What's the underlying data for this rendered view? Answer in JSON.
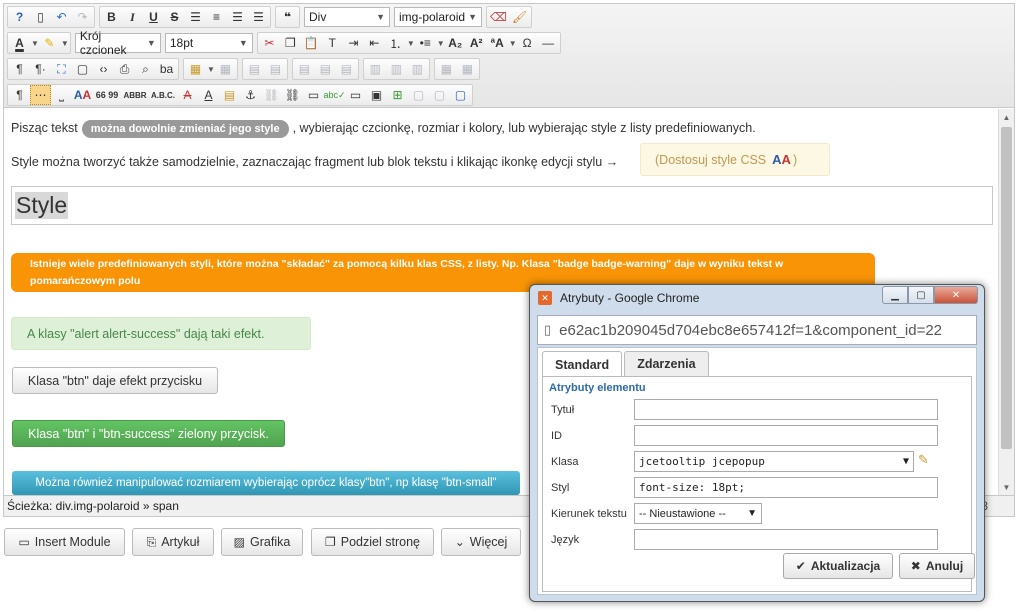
{
  "toolbar": {
    "format_select": "Div",
    "class_select": "img-polaroid",
    "font_family_select": "Krój czcionek",
    "font_size_select": "18pt"
  },
  "content": {
    "p1_before": "Pisząc tekst",
    "p1_badge": "można dowolnie zmieniać jego style",
    "p1_after": ", wybierając czcionkę, rozmiar i kolory, lub wybierając style z listy predefiniowanych.",
    "p2": "Style można tworzyć także samodzielnie, zaznaczając fragment lub blok tekstu i klikając ikonkę edycji stylu →",
    "css_tip_open": "(Dostosuj style CSS",
    "css_tip_close": ")",
    "heading": "Style",
    "warning_text": "Istnieje wiele predefiniowanych styli, które można \"składać\" za pomocą kilku klas CSS, z listy. Np. Klasa \"badge badge-warning\"  daje w wyniku tekst w pomarańczowym polu",
    "alert_text": "A klasy \"alert alert-success\" dają taki efekt.",
    "btn_default": "Klasa \"btn\" daje efekt przycisku",
    "btn_success": "Klasa \"btn\" i \"btn-success\" zielony przycisk.",
    "btn_info": "Można również manipulować rozmiarem wybierając oprócz klasy\"btn\", np klasę \"btn-small\""
  },
  "statusbar": {
    "path": "Ścieżka: div.img-polaroid » span",
    "count": "3"
  },
  "bottom_buttons": [
    {
      "label": "Insert Module"
    },
    {
      "label": "Artykuł"
    },
    {
      "label": "Grafika"
    },
    {
      "label": "Podziel stronę"
    },
    {
      "label": "Więcej"
    }
  ],
  "dialog": {
    "title": "Atrybuty - Google Chrome",
    "url": "e62ac1b209045d704ebc8e657412f=1&component_id=22",
    "tab_standard": "Standard",
    "tab_events": "Zdarzenia",
    "section": "Atrybuty elementu",
    "labels": {
      "title": "Tytuł",
      "id": "ID",
      "class": "Klasa",
      "style": "Styl",
      "direction": "Kierunek tekstu",
      "lang": "Język"
    },
    "values": {
      "title": "",
      "id": "",
      "class": "jcetooltip jcepopup",
      "style": "font-size: 18pt;",
      "direction": "-- Nieustawione --",
      "lang": ""
    },
    "update_button": "Aktualizacja",
    "cancel_button": "Anuluj"
  },
  "colors": {
    "warning": "#f89406",
    "success_bg": "#dff0d8",
    "success_btn": "#51a351",
    "info_btn": "#2f96b4",
    "badge": "#999999",
    "dialog_frame": "#cfdcec"
  }
}
